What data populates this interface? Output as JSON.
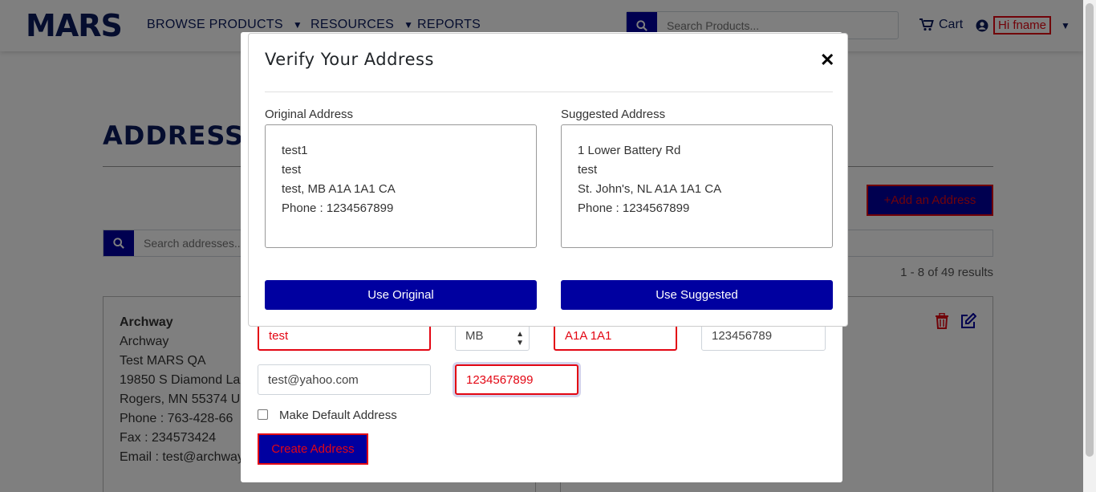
{
  "header": {
    "logo": "MARS",
    "nav": [
      {
        "label": "BROWSE PRODUCTS",
        "has_dropdown": true
      },
      {
        "label": "RESOURCES",
        "has_dropdown": true
      },
      {
        "label": "REPORTS",
        "has_dropdown": false
      }
    ],
    "search_placeholder": "Search Products...",
    "cart_label": "Cart",
    "user_label": "Hi fname"
  },
  "page": {
    "title": "ADDRESSES",
    "add_button": "Add an Address",
    "search_placeholder": "Search addresses...",
    "results": "1 - 8 of 49 results",
    "address_card": {
      "name": "Archway",
      "lines": [
        "Archway",
        "Test MARS QA",
        "19850 S Diamond La",
        "Rogers, MN 55374 U",
        "Phone : 763-428-66",
        "Fax : 234573424",
        "Email : test@archway"
      ]
    }
  },
  "create_form": {
    "city_value": "test",
    "state_value": "MB",
    "postal_value": "A1A 1A1",
    "fax_value": "123456789",
    "email_value": "test@yahoo.com",
    "phone_value": "1234567899",
    "default_checkbox_label": "Make Default Address",
    "default_checked": false,
    "submit_label": "Create Address"
  },
  "verify_modal": {
    "title": "Verify Your Address",
    "original": {
      "label": "Original Address",
      "lines": [
        "test1",
        "test",
        "test, MB A1A 1A1 CA",
        "Phone : 1234567899"
      ],
      "button": "Use Original"
    },
    "suggested": {
      "label": "Suggested Address",
      "lines": [
        "1 Lower Battery Rd",
        "test",
        "St. John's, NL A1A 1A1 CA",
        "Phone : 1234567899"
      ],
      "button": "Use Suggested"
    }
  },
  "colors": {
    "brand_navy": "#0a1a5c",
    "button_blue": "#0000a0",
    "error_red": "#e30613",
    "trash_red": "#e30613"
  },
  "icons": [
    "search-icon",
    "cart-icon",
    "user-circle-icon",
    "caret-down-icon",
    "plus-icon",
    "trash-icon",
    "edit-icon",
    "close-icon"
  ]
}
